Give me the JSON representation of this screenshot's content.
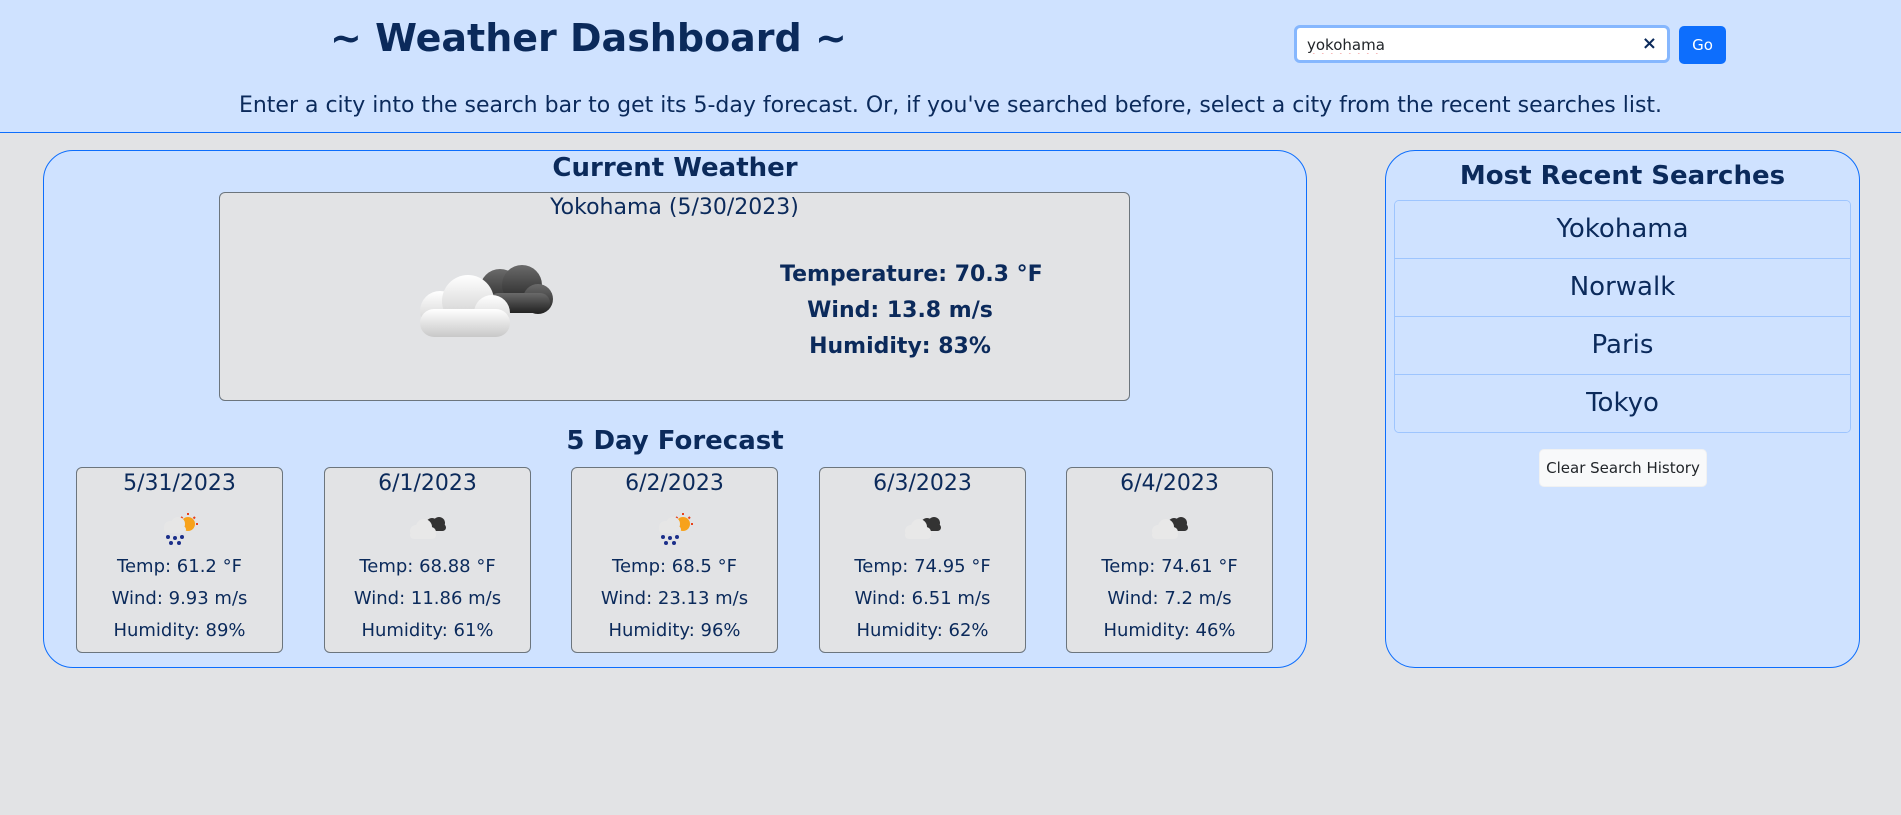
{
  "header": {
    "title": "~ Weather Dashboard ~",
    "subtitle": "Enter a city into the search bar to get its 5-day forecast. Or, if you've searched before, select a city from the recent searches list."
  },
  "search": {
    "value": "yokohama",
    "clear_glyph": "×",
    "go_label": "Go"
  },
  "current": {
    "heading": "Current Weather",
    "city_date": "Yokohama (5/30/2023)",
    "icon": "broken-clouds-icon",
    "temperature": "Temperature: 70.3 °F",
    "wind": "Wind: 13.8 m/s",
    "humidity": "Humidity: 83%"
  },
  "forecast": {
    "heading": "5 Day Forecast",
    "days": [
      {
        "date": "5/31/2023",
        "icon": "rain-sun-icon",
        "temp": "Temp: 61.2 °F",
        "wind": "Wind: 9.93 m/s",
        "humidity": "Humidity: 89%"
      },
      {
        "date": "6/1/2023",
        "icon": "cloud-icon",
        "temp": "Temp: 68.88 °F",
        "wind": "Wind: 11.86 m/s",
        "humidity": "Humidity: 61%"
      },
      {
        "date": "6/2/2023",
        "icon": "rain-sun-icon",
        "temp": "Temp: 68.5 °F",
        "wind": "Wind: 23.13 m/s",
        "humidity": "Humidity: 96%"
      },
      {
        "date": "6/3/2023",
        "icon": "cloud-icon",
        "temp": "Temp: 74.95 °F",
        "wind": "Wind: 6.51 m/s",
        "humidity": "Humidity: 62%"
      },
      {
        "date": "6/4/2023",
        "icon": "cloud-icon",
        "temp": "Temp: 74.61 °F",
        "wind": "Wind: 7.2 m/s",
        "humidity": "Humidity: 46%"
      }
    ]
  },
  "recent": {
    "heading": "Most Recent Searches",
    "items": [
      "Yokohama",
      "Norwalk",
      "Paris",
      "Tokyo"
    ],
    "clear_label": "Clear Search History"
  },
  "colors": {
    "panel_bg": "#cfe2ff",
    "page_bg": "#e2e3e5",
    "accent": "#0d6efd",
    "text": "#0b2a5b"
  }
}
